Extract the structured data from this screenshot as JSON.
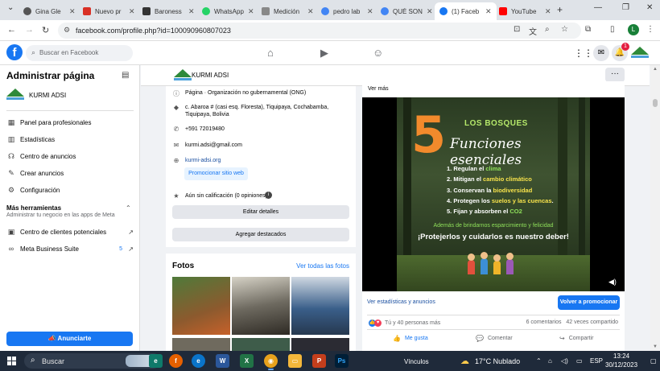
{
  "browser": {
    "tabs": [
      {
        "title": "Gina Gle",
        "color": "#555555",
        "active": false
      },
      {
        "title": "Nuevo pr",
        "color": "#d93025",
        "active": false
      },
      {
        "title": "Baroness",
        "color": "#333333",
        "active": false
      },
      {
        "title": "WhatsApp",
        "color": "#25d366",
        "active": false
      },
      {
        "title": "Medición",
        "color": "#888888",
        "active": false
      },
      {
        "title": "pedro lab",
        "color": "#4285f4",
        "active": false
      },
      {
        "title": "QUÉ SON",
        "color": "#4285f4",
        "active": false
      },
      {
        "title": "(1) Faceb",
        "color": "#1877f2",
        "active": true
      },
      {
        "title": "YouTube",
        "color": "#ff0000",
        "active": false
      }
    ],
    "url": "facebook.com/profile.php?id=100090960807023",
    "profile_initial": "L"
  },
  "facebook": {
    "logo": "f",
    "search_placeholder": "Buscar en Facebook",
    "notifications_count": "1"
  },
  "sidebar": {
    "title": "Administrar página",
    "page_name": "KURMI ADSI",
    "items": [
      {
        "label": "Panel para profesionales",
        "icon": "grid-icon"
      },
      {
        "label": "Estadísticas",
        "icon": "chart-icon"
      },
      {
        "label": "Centro de anuncios",
        "icon": "megaphone-icon"
      },
      {
        "label": "Crear anuncios",
        "icon": "edit-icon"
      },
      {
        "label": "Configuración",
        "icon": "gear-icon"
      }
    ],
    "more_tools_title": "Más herramientas",
    "more_tools_subtitle": "Administrar tu negocio en las apps de Meta",
    "tools": [
      {
        "label": "Centro de clientes potenciales",
        "badge": ""
      },
      {
        "label": "Meta Business Suite",
        "badge": "5"
      }
    ],
    "promote_button": "Anunciarte"
  },
  "page_header": {
    "name": "KURMI ADSI",
    "more": "···"
  },
  "info": {
    "category": "Página · Organización no gubernamental (ONG)",
    "address": "c. Abaroa # (casi esq. Floresta), Tiquipaya, Cochabamba, Tiquipaya, Bolivia",
    "phone": "+591 72019480",
    "email": "kurmi.adsi@gmail.com",
    "website": "kurmi-adsi.org",
    "promote_web": "Promocionar sitio web",
    "rating": "Aún sin calificación (0 opiniones)",
    "edit_details": "Editar detalles",
    "add_featured": "Agregar destacados"
  },
  "photos": {
    "title": "Fotos",
    "see_all": "Ver todas las fotos"
  },
  "post": {
    "see_more": "Ver más",
    "video": {
      "number": "5",
      "heading": "LOS BOSQUES",
      "subtitle": "Funciones esenciales",
      "items": [
        {
          "n": "1.",
          "pre": "Regulan el ",
          "hl": "clima",
          "post": ""
        },
        {
          "n": "2.",
          "pre": "Mitigan el ",
          "hl": "cambio climático",
          "post": ""
        },
        {
          "n": "3.",
          "pre": "Conservan la ",
          "hl": "biodiversidad",
          "post": ""
        },
        {
          "n": "4.",
          "pre": "Protegen los ",
          "hl": "suelos y las cuencas",
          "post": "."
        },
        {
          "n": "5.",
          "pre": "Fijan y absorben el ",
          "hl": "CO2",
          "post": ""
        }
      ],
      "also": "Además de brindarnos esparcimiento y felicidad",
      "slogan": "¡Protejerlos y cuidarlos es nuestro deber!"
    },
    "stats_link": "Ver estadísticas y anuncios",
    "boost_again": "Volver a promocionar",
    "reactions": "Tú y 40 personas más",
    "comments": "6 comentarios",
    "shares": "42 veces compartido",
    "like": "Me gusta",
    "comment": "Comentar",
    "share": "Compartir"
  },
  "taskbar": {
    "search": "Buscar",
    "apps": [
      {
        "name": "edge",
        "color": "#0f7a6a",
        "glyph": "e"
      },
      {
        "name": "firefox",
        "color": "#e66000",
        "glyph": "f"
      },
      {
        "name": "edge-blue",
        "color": "#0a74c9",
        "glyph": "e"
      },
      {
        "name": "word",
        "color": "#2b579a",
        "glyph": "W"
      },
      {
        "name": "excel",
        "color": "#217346",
        "glyph": "X"
      },
      {
        "name": "chrome",
        "color": "#e8a21c",
        "glyph": "◉"
      },
      {
        "name": "files",
        "color": "#f3b73b",
        "glyph": "▭"
      },
      {
        "name": "powerpoint",
        "color": "#c43e1c",
        "glyph": "P"
      },
      {
        "name": "photoshop",
        "color": "#001e36",
        "glyph": "Ps"
      }
    ],
    "links": "Vínculos",
    "weather": "17°C  Nublado",
    "lang": "ESP",
    "time": "13:24",
    "date": "30/12/2023"
  }
}
